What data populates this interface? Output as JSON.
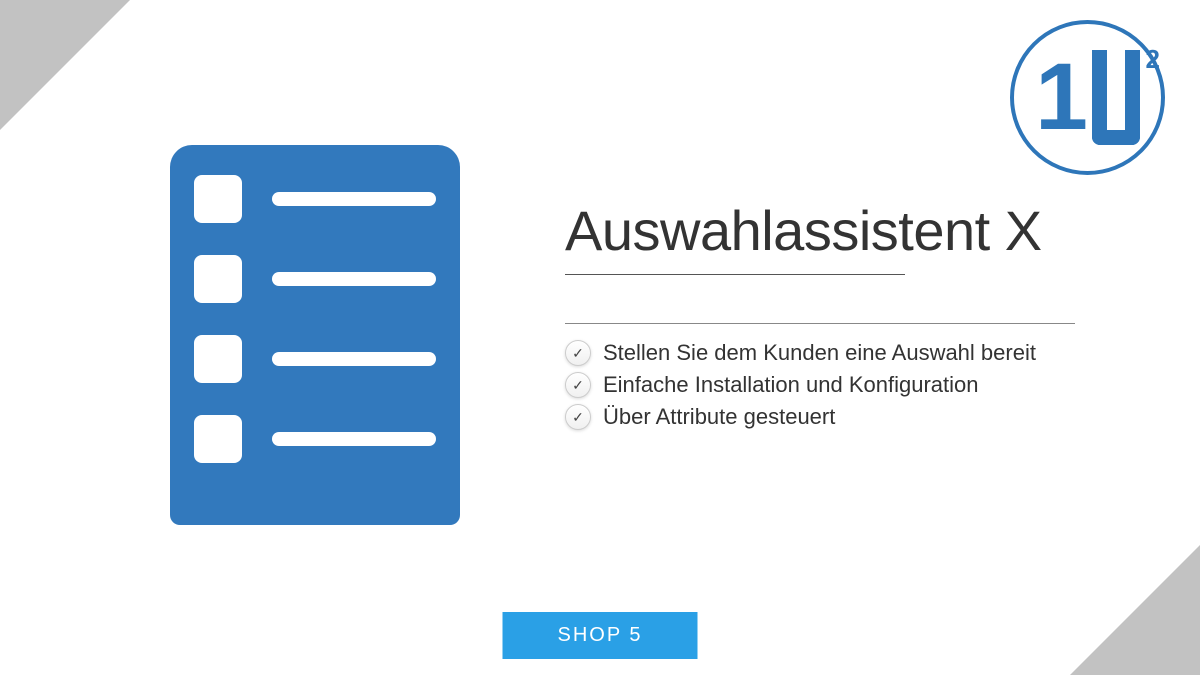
{
  "logo": {
    "digit1": "1",
    "exponent": "2"
  },
  "title": "Auswahlassistent X",
  "features": [
    "Stellen Sie dem Kunden eine Auswahl bereit",
    "Einfache Installation und Konfiguration",
    "Über Attribute gesteuert"
  ],
  "button_label": "SHOP 5",
  "colors": {
    "primary": "#3279bd",
    "accent": "#2aa0e6",
    "corner": "#c2c2c2"
  }
}
